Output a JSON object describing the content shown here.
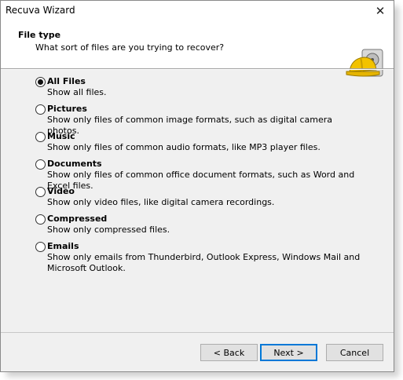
{
  "window": {
    "title": "Recuva Wizard"
  },
  "header": {
    "title": "File type",
    "subtitle": "What sort of files are you trying to recover?"
  },
  "options": [
    {
      "label": "All Files",
      "description": "Show all files.",
      "checked": true
    },
    {
      "label": "Pictures",
      "description": "Show only files of common image formats, such as digital camera photos.",
      "checked": false
    },
    {
      "label": "Music",
      "description": "Show only files of common audio formats, like MP3 player files.",
      "checked": false
    },
    {
      "label": "Documents",
      "description": "Show only files of common office document formats, such as Word and Excel files.",
      "checked": false
    },
    {
      "label": "Video",
      "description": "Show only video files, like digital camera recordings.",
      "checked": false
    },
    {
      "label": "Compressed",
      "description": "Show only compressed files.",
      "checked": false
    },
    {
      "label": "Emails",
      "description": "Show only emails from Thunderbird, Outlook Express, Windows Mail and Microsoft Outlook.",
      "checked": false
    }
  ],
  "buttons": {
    "back": "< Back",
    "next": "Next >",
    "cancel": "Cancel"
  },
  "icons": {
    "close": "close-icon",
    "wizard": "hardhat-disk-icon"
  }
}
